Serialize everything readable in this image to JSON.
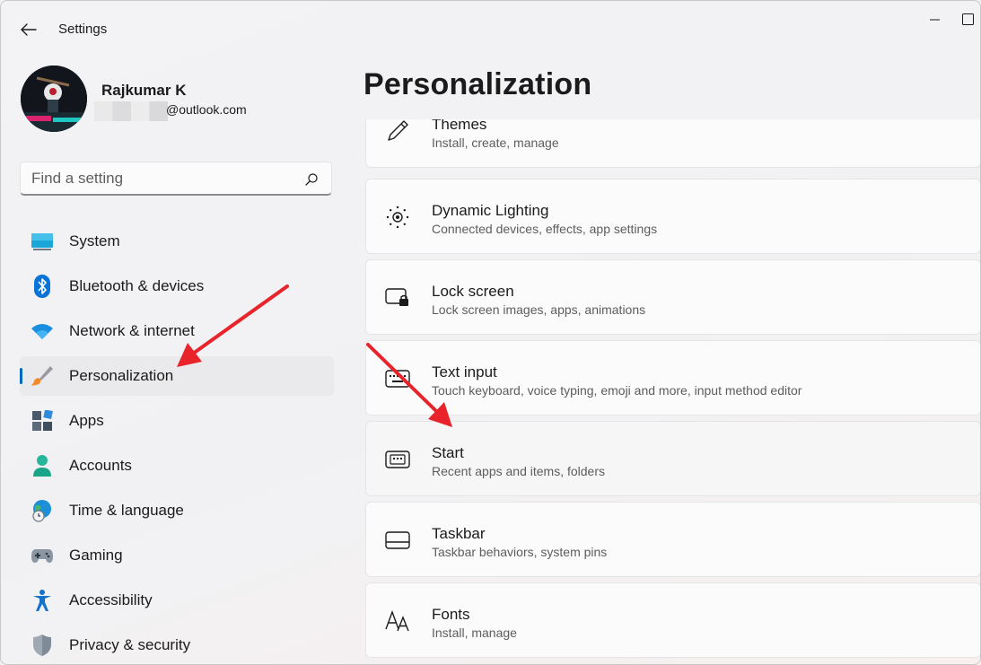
{
  "titlebar": {
    "title": "Settings"
  },
  "profile": {
    "name": "Rajkumar K",
    "email": "@outlook.com"
  },
  "search": {
    "placeholder": "Find a setting"
  },
  "nav": [
    {
      "label": "System",
      "icon": "monitor-icon"
    },
    {
      "label": "Bluetooth & devices",
      "icon": "bluetooth-icon"
    },
    {
      "label": "Network & internet",
      "icon": "wifi-icon"
    },
    {
      "label": "Personalization",
      "icon": "paintbrush-icon",
      "selected": true
    },
    {
      "label": "Apps",
      "icon": "apps-icon"
    },
    {
      "label": "Accounts",
      "icon": "person-icon"
    },
    {
      "label": "Time & language",
      "icon": "globe-clock-icon"
    },
    {
      "label": "Gaming",
      "icon": "gamepad-icon"
    },
    {
      "label": "Accessibility",
      "icon": "accessibility-icon"
    },
    {
      "label": "Privacy & security",
      "icon": "shield-icon"
    }
  ],
  "main": {
    "title": "Personalization",
    "cards": [
      {
        "title": "Themes",
        "subtitle": "Install, create, manage",
        "icon": "pen-icon"
      },
      {
        "title": "Dynamic Lighting",
        "subtitle": "Connected devices, effects, app settings",
        "icon": "lighting-icon"
      },
      {
        "title": "Lock screen",
        "subtitle": "Lock screen images, apps, animations",
        "icon": "lock-screen-icon"
      },
      {
        "title": "Text input",
        "subtitle": "Touch keyboard, voice typing, emoji and more, input method editor",
        "icon": "keyboard-icon"
      },
      {
        "title": "Start",
        "subtitle": "Recent apps and items, folders",
        "icon": "start-icon"
      },
      {
        "title": "Taskbar",
        "subtitle": "Taskbar behaviors, system pins",
        "icon": "taskbar-icon"
      },
      {
        "title": "Fonts",
        "subtitle": "Install, manage",
        "icon": "fonts-icon"
      }
    ]
  },
  "colors": {
    "accent": "#0067c0",
    "annotation_arrow": "#e8232a"
  }
}
